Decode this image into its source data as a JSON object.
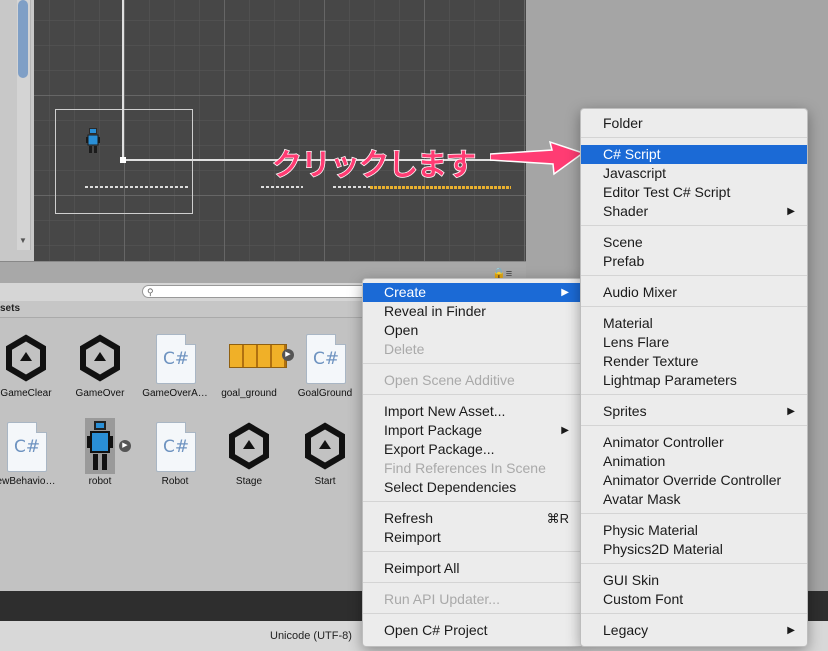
{
  "annotation": {
    "text": "クリックします",
    "color": "#ff3c73"
  },
  "project_panel": {
    "search_placeholder": "",
    "header_label": "sets",
    "assets": [
      {
        "label": "GameClear",
        "type": "unity-scene"
      },
      {
        "label": "GameOver",
        "type": "unity-scene"
      },
      {
        "label": "GameOverA…",
        "type": "csharp-script"
      },
      {
        "label": "goal_ground",
        "type": "sprite"
      },
      {
        "label": "GoalGround",
        "type": "csharp-script"
      },
      {
        "label": "ewBehavio…",
        "type": "csharp-script"
      },
      {
        "label": "robot",
        "type": "sprite"
      },
      {
        "label": "Robot",
        "type": "csharp-script"
      },
      {
        "label": "Stage",
        "type": "unity-scene"
      },
      {
        "label": "Start",
        "type": "unity-scene"
      }
    ],
    "csharp_icon_text": "C#"
  },
  "status_bar": {
    "encoding": "Unicode (UTF-8)"
  },
  "context_menu": {
    "items": [
      {
        "label": "Create",
        "highlighted": true,
        "submenu": true
      },
      {
        "label": "Reveal in Finder"
      },
      {
        "label": "Open"
      },
      {
        "label": "Delete",
        "disabled": true
      },
      {
        "label": "Open Scene Additive",
        "disabled": true
      },
      {
        "label": "Import New Asset..."
      },
      {
        "label": "Import Package",
        "submenu": true
      },
      {
        "label": "Export Package..."
      },
      {
        "label": "Find References In Scene",
        "disabled": true
      },
      {
        "label": "Select Dependencies"
      },
      {
        "label": "Refresh",
        "shortcut": "⌘R"
      },
      {
        "label": "Reimport"
      },
      {
        "label": "Reimport All"
      },
      {
        "label": "Run API Updater...",
        "disabled": true
      },
      {
        "label": "Open C# Project"
      }
    ]
  },
  "create_submenu": {
    "items": [
      {
        "label": "Folder"
      },
      {
        "label": "C# Script",
        "highlighted": true
      },
      {
        "label": "Javascript"
      },
      {
        "label": "Editor Test C# Script"
      },
      {
        "label": "Shader",
        "submenu": true
      },
      {
        "label": "Scene"
      },
      {
        "label": "Prefab"
      },
      {
        "label": "Audio Mixer"
      },
      {
        "label": "Material"
      },
      {
        "label": "Lens Flare"
      },
      {
        "label": "Render Texture"
      },
      {
        "label": "Lightmap Parameters"
      },
      {
        "label": "Sprites",
        "submenu": true
      },
      {
        "label": "Animator Controller"
      },
      {
        "label": "Animation"
      },
      {
        "label": "Animator Override Controller"
      },
      {
        "label": "Avatar Mask"
      },
      {
        "label": "Physic Material"
      },
      {
        "label": "Physics2D Material"
      },
      {
        "label": "GUI Skin"
      },
      {
        "label": "Custom Font"
      },
      {
        "label": "Legacy",
        "submenu": true
      }
    ]
  },
  "colors": {
    "highlight": "#1b6ad6",
    "scene_bg": "#474747",
    "goal": "#e8b030"
  }
}
